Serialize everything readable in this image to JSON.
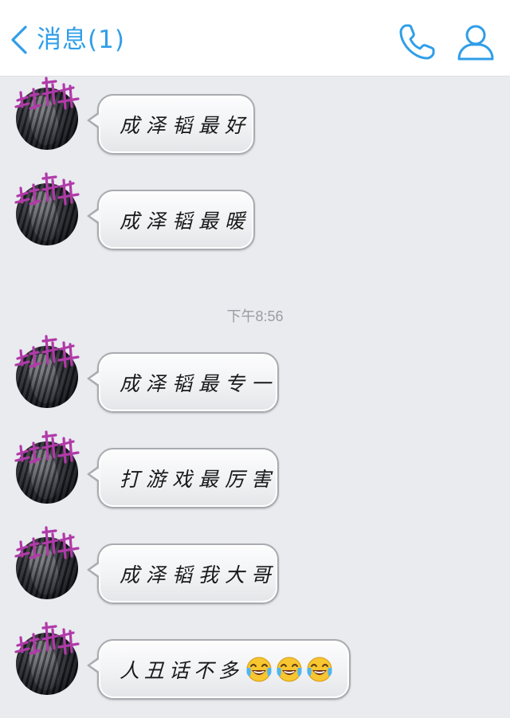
{
  "header": {
    "back_label": "消息(1)",
    "phone_icon": "phone-icon",
    "contact_icon": "contact-icon"
  },
  "colors": {
    "accent": "#2f9ee8",
    "background": "#e9ebef",
    "watermark": "#b03aa8"
  },
  "timestamp": "下午8:56",
  "messages": [
    {
      "text": "成泽韬最好"
    },
    {
      "text": "成泽韬最暖"
    },
    {
      "text": "成泽韬最专一"
    },
    {
      "text": "打游戏最厉害"
    },
    {
      "text": "成泽韬我大哥"
    },
    {
      "text": "人丑话不多",
      "emoji": [
        "face-with-tears-of-joy",
        "face-with-tears-of-joy",
        "face-with-tears-of-joy"
      ]
    }
  ],
  "avatar_watermark": "一級暢快"
}
